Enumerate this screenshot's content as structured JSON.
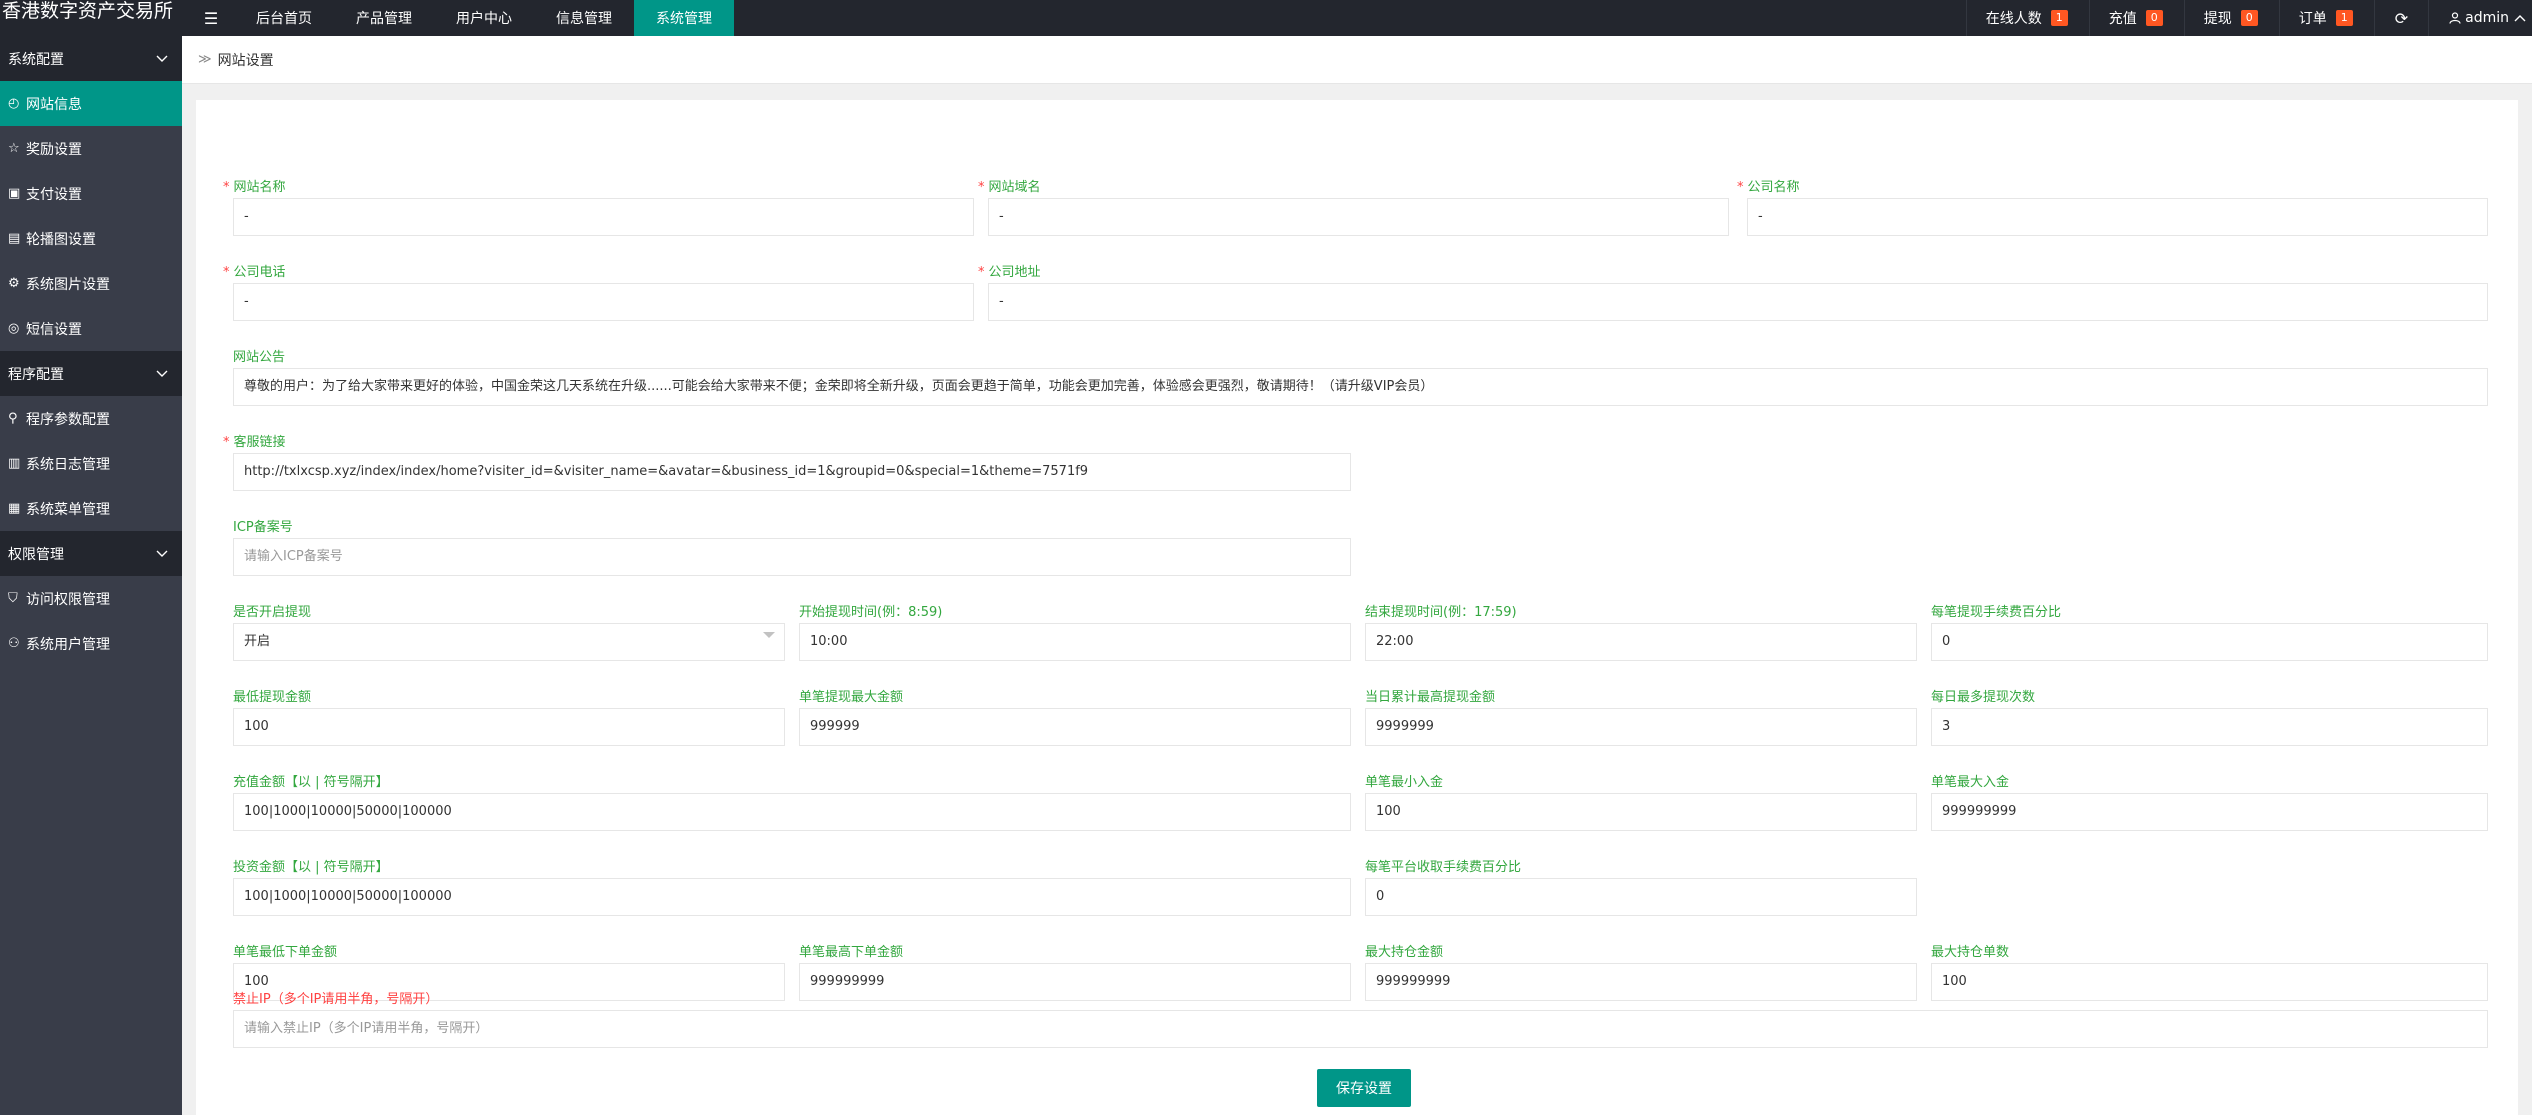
{
  "app": {
    "title": "香港数字资产交易所"
  },
  "topbar": {
    "menu_icon": "☰",
    "nav": [
      "后台首页",
      "产品管理",
      "用户中心",
      "信息管理",
      "系统管理"
    ],
    "online": {
      "label": "在线人数",
      "count": "1"
    },
    "recharge": {
      "label": "充值",
      "count": "0"
    },
    "withdraw": {
      "label": "提现",
      "count": "0"
    },
    "orders": {
      "label": "订单",
      "count": "1"
    },
    "refresh_icon": "⟳",
    "user": "admin"
  },
  "sidebar": {
    "groups": [
      {
        "label": "系统配置",
        "items": [
          {
            "label": "网站信息",
            "icon": "◴",
            "active": true
          },
          {
            "label": "奖励设置",
            "icon": "☆"
          },
          {
            "label": "支付设置",
            "icon": "▣"
          },
          {
            "label": "轮播图设置",
            "icon": "▤"
          },
          {
            "label": "系统图片设置",
            "icon": "⚙"
          },
          {
            "label": "短信设置",
            "icon": "◎"
          }
        ]
      },
      {
        "label": "程序配置",
        "items": [
          {
            "label": "程序参数配置",
            "icon": "⚲"
          },
          {
            "label": "系统日志管理",
            "icon": "▥"
          },
          {
            "label": "系统菜单管理",
            "icon": "▦"
          }
        ]
      },
      {
        "label": "权限管理",
        "items": [
          {
            "label": "访问权限管理",
            "icon": "⛉"
          },
          {
            "label": "系统用户管理",
            "icon": "⚇"
          }
        ]
      }
    ]
  },
  "breadcrumb": {
    "sep": "≫",
    "label": "网站设置"
  },
  "form": {
    "site_name": {
      "label": "网站名称",
      "value": "-"
    },
    "site_domain": {
      "label": "网站域名",
      "value": "-"
    },
    "company_name": {
      "label": "公司名称",
      "value": "-"
    },
    "company_phone": {
      "label": "公司电话",
      "value": "-"
    },
    "company_address": {
      "label": "公司地址",
      "value": "-"
    },
    "notice": {
      "label": "网站公告",
      "value": "尊敬的用户：为了给大家带来更好的体验，中国金荣这几天系统在升级......可能会给大家带来不便；金荣即将全新升级，页面会更趋于简单，功能会更加完善，体验感会更强烈，敬请期待！（请升级VIP会员）"
    },
    "service_link": {
      "label": "客服链接",
      "value": "http://txlxcsp.xyz/index/index/home?visiter_id=&visiter_name=&avatar=&business_id=1&groupid=0&special=1&theme=7571f9"
    },
    "icp": {
      "label": "ICP备案号",
      "placeholder": "请输入ICP备案号"
    },
    "withdraw_enabled": {
      "label": "是否开启提现",
      "value": "开启"
    },
    "withdraw_start": {
      "label": "开始提现时间(例：8:59)",
      "value": "10:00"
    },
    "withdraw_end": {
      "label": "结束提现时间(例：17:59)",
      "value": "22:00"
    },
    "withdraw_fee": {
      "label": "每笔提现手续费百分比",
      "value": "0"
    },
    "withdraw_min": {
      "label": "最低提现金额",
      "value": "100"
    },
    "withdraw_max_single": {
      "label": "单笔提现最大金额",
      "value": "999999"
    },
    "withdraw_max_daily": {
      "label": "当日累计最高提现金额",
      "value": "9999999"
    },
    "withdraw_times_daily": {
      "label": "每日最多提现次数",
      "value": "3"
    },
    "recharge_amounts": {
      "label": "充值金额【以 | 符号隔开】",
      "value": "100|1000|10000|50000|100000"
    },
    "deposit_min": {
      "label": "单笔最小入金",
      "value": "100"
    },
    "deposit_max": {
      "label": "单笔最大入金",
      "value": "999999999"
    },
    "invest_amounts": {
      "label": "投资金额【以 | 符号隔开】",
      "value": "100|1000|10000|50000|100000"
    },
    "platform_fee": {
      "label": "每笔平台收取手续费百分比",
      "value": "0"
    },
    "order_min": {
      "label": "单笔最低下单金额",
      "value": "100"
    },
    "order_max": {
      "label": "单笔最高下单金额",
      "value": "999999999"
    },
    "position_max_amount": {
      "label": "最大持仓金额",
      "value": "999999999"
    },
    "position_max_count": {
      "label": "最大持仓单数",
      "value": "100"
    },
    "banned_ip": {
      "label": "禁止IP",
      "label_note": "（多个IP请用半角，号隔开）",
      "placeholder": "请输入禁止IP（多个IP请用半角，号隔开）"
    },
    "save_label": "保存设置"
  },
  "colors": {
    "accent": "#009688",
    "label_green": "#33a73f",
    "required": "#ff4242",
    "badge": "#ff5722"
  }
}
